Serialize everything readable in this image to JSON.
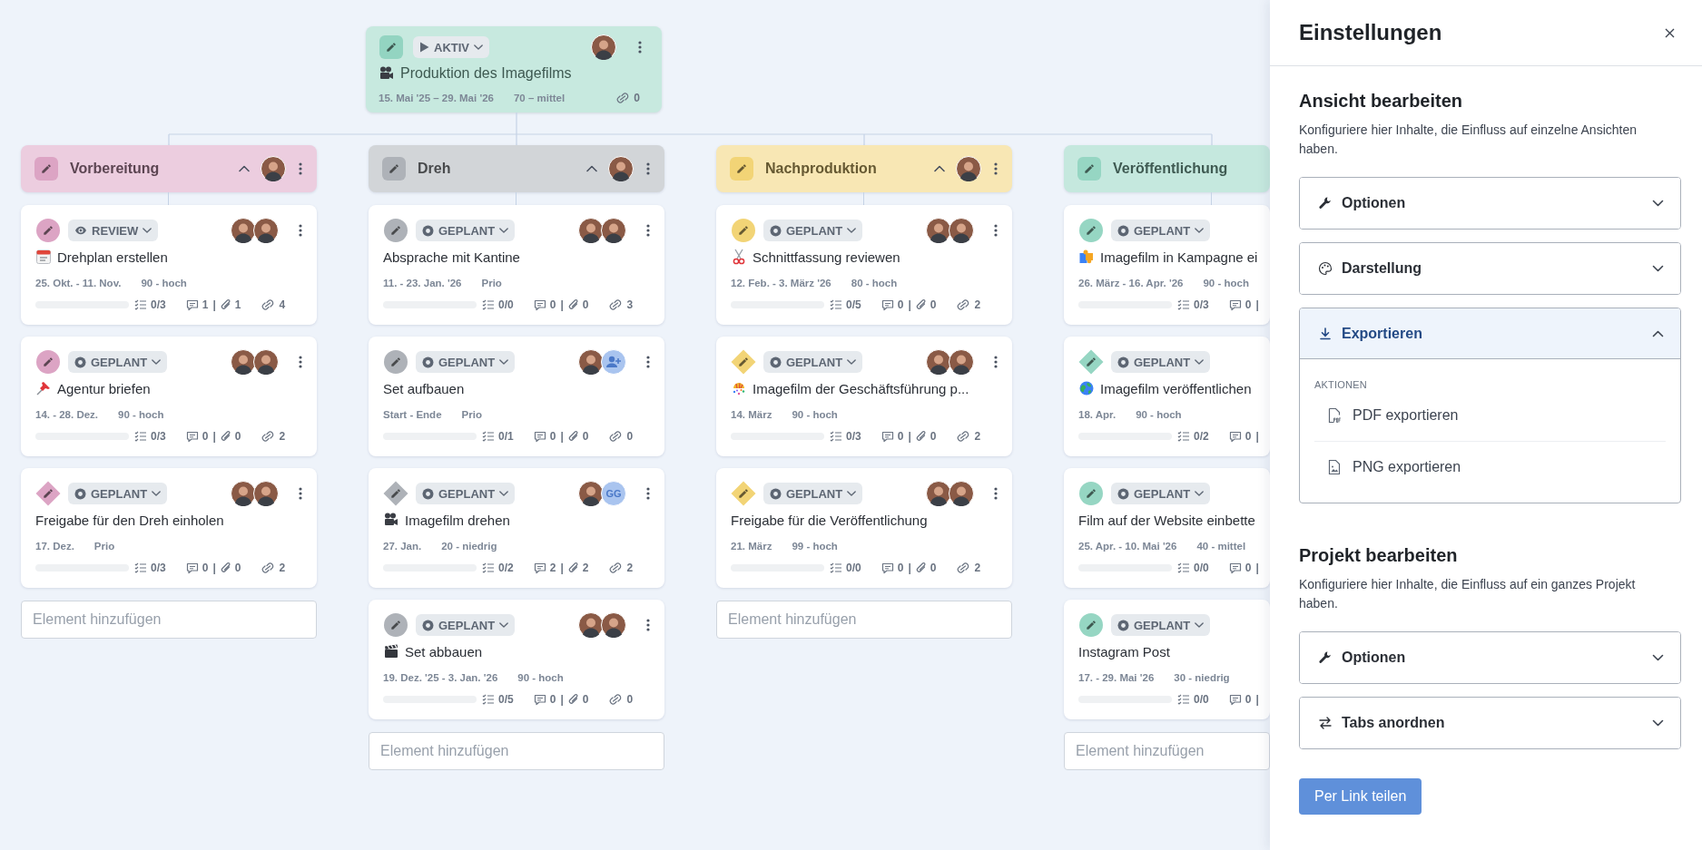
{
  "root_card": {
    "color": "#93d4c1",
    "status": {
      "kind": "active",
      "label": "AKTIV"
    },
    "avatars": [
      {
        "kind": "photo"
      }
    ],
    "title_icon": {
      "kind": "projector"
    },
    "title": "Produktion des Imagefilms",
    "date": "15. Mai '25 – 29. Mai '26",
    "priority": "70 – mittel",
    "links": "0"
  },
  "columns": [
    {
      "title": "Vorbereitung",
      "color": "#dca4c4",
      "collapse": true,
      "avatars": [
        {
          "kind": "photo"
        }
      ],
      "menu": true,
      "add_placeholder": "Element hinzufügen",
      "cards": [
        {
          "kind": "task",
          "status": {
            "kind": "review",
            "label": "REVIEW"
          },
          "avatars": [
            {
              "kind": "photo"
            },
            {
              "kind": "photo"
            }
          ],
          "menu": true,
          "title_icon": {
            "kind": "calendar"
          },
          "title": "Drehplan erstellen",
          "date": "25. Okt. - 11. Nov.",
          "priority": "90 - hoch",
          "level": 0,
          "stats": [
            {
              "kind": "checklist",
              "text": "0/3"
            },
            {
              "kind": "comments",
              "text": "1"
            },
            {
              "kind": "separator",
              "text": "|"
            },
            {
              "kind": "attachments",
              "text": "1"
            },
            {
              "kind": "links",
              "text": "4"
            }
          ]
        },
        {
          "kind": "task",
          "status": {
            "kind": "planned",
            "label": "GEPLANT"
          },
          "avatars": [
            {
              "kind": "photo"
            },
            {
              "kind": "photo"
            }
          ],
          "menu": true,
          "title_icon": {
            "kind": "pin"
          },
          "title": "Agentur briefen",
          "date": "14. - 28. Dez.",
          "priority": "90 - hoch",
          "level": 0,
          "stats": [
            {
              "kind": "checklist",
              "text": "0/3"
            },
            {
              "kind": "comments",
              "text": "0"
            },
            {
              "kind": "separator",
              "text": "|"
            },
            {
              "kind": "attachments",
              "text": "0"
            },
            {
              "kind": "links",
              "text": "2"
            }
          ]
        },
        {
          "kind": "milestone",
          "status": {
            "kind": "planned",
            "label": "GEPLANT"
          },
          "avatars": [
            {
              "kind": "photo"
            },
            {
              "kind": "photo"
            }
          ],
          "menu": true,
          "title": "Freigabe für den Dreh einholen",
          "date": "17. Dez.",
          "priority": "Prio",
          "level": 0,
          "stats": [
            {
              "kind": "checklist",
              "text": "0/3"
            },
            {
              "kind": "comments",
              "text": "0"
            },
            {
              "kind": "separator",
              "text": "|"
            },
            {
              "kind": "attachments",
              "text": "0"
            },
            {
              "kind": "links",
              "text": "2"
            }
          ]
        }
      ]
    },
    {
      "title": "Dreh",
      "color": "#aeb2b8",
      "collapse": true,
      "avatars": [
        {
          "kind": "photo"
        }
      ],
      "menu": true,
      "add_placeholder": "Element hinzufügen",
      "cards": [
        {
          "kind": "task",
          "status": {
            "kind": "planned",
            "label": "GEPLANT"
          },
          "avatars": [
            {
              "kind": "photo"
            },
            {
              "kind": "photo"
            }
          ],
          "menu": true,
          "title": "Absprache mit Kantine",
          "date": "11. - 23. Jan. '26",
          "priority": "Prio",
          "level": 0,
          "stats": [
            {
              "kind": "checklist",
              "text": "0/0"
            },
            {
              "kind": "comments",
              "text": "0"
            },
            {
              "kind": "separator",
              "text": "|"
            },
            {
              "kind": "attachments",
              "text": "0"
            },
            {
              "kind": "links",
              "text": "3"
            }
          ]
        },
        {
          "kind": "task",
          "status": {
            "kind": "planned",
            "label": "GEPLANT"
          },
          "avatars": [
            {
              "kind": "photo"
            },
            {
              "kind": "add"
            }
          ],
          "menu": true,
          "title": "Set aufbauen",
          "date": "Start - Ende",
          "priority": "Prio",
          "level": 0,
          "stats": [
            {
              "kind": "checklist",
              "text": "0/1"
            },
            {
              "kind": "comments",
              "text": "0"
            },
            {
              "kind": "separator",
              "text": "|"
            },
            {
              "kind": "attachments",
              "text": "0"
            },
            {
              "kind": "links",
              "text": "0"
            }
          ]
        },
        {
          "kind": "milestone",
          "status": {
            "kind": "planned",
            "label": "GEPLANT"
          },
          "avatars": [
            {
              "kind": "photo"
            },
            {
              "kind": "initials",
              "text": "GG"
            }
          ],
          "menu": true,
          "title_icon": {
            "kind": "projector"
          },
          "title": "Imagefilm drehen",
          "date": "27. Jan.",
          "priority": "20 - niedrig",
          "level": 0,
          "stats": [
            {
              "kind": "checklist",
              "text": "0/2"
            },
            {
              "kind": "comments",
              "text": "2"
            },
            {
              "kind": "separator",
              "text": "|"
            },
            {
              "kind": "attachments",
              "text": "2"
            },
            {
              "kind": "links",
              "text": "2"
            }
          ]
        },
        {
          "kind": "task",
          "status": {
            "kind": "planned",
            "label": "GEPLANT"
          },
          "avatars": [
            {
              "kind": "photo"
            },
            {
              "kind": "photo"
            }
          ],
          "menu": true,
          "title_icon": {
            "kind": "clapper"
          },
          "title": "Set abbauen",
          "date": "19. Dez. '25 - 3. Jan. '26",
          "priority": "90 - hoch",
          "level": 0,
          "stats": [
            {
              "kind": "checklist",
              "text": "0/5"
            },
            {
              "kind": "comments",
              "text": "0"
            },
            {
              "kind": "separator",
              "text": "|"
            },
            {
              "kind": "attachments",
              "text": "0"
            },
            {
              "kind": "links",
              "text": "0"
            }
          ]
        }
      ]
    },
    {
      "title": "Nachproduktion",
      "color": "#f2d476",
      "collapse": true,
      "avatars": [
        {
          "kind": "photo"
        }
      ],
      "menu": true,
      "add_placeholder": "Element hinzufügen",
      "cards": [
        {
          "kind": "task",
          "status": {
            "kind": "planned",
            "label": "GEPLANT"
          },
          "avatars": [
            {
              "kind": "photo"
            },
            {
              "kind": "photo"
            }
          ],
          "menu": true,
          "title_icon": {
            "kind": "scissors"
          },
          "title": "Schnittfassung reviewen",
          "date": "12. Feb. - 3. März '26",
          "priority": "80 - hoch",
          "level": 0,
          "stats": [
            {
              "kind": "checklist",
              "text": "0/5"
            },
            {
              "kind": "comments",
              "text": "0"
            },
            {
              "kind": "separator",
              "text": "|"
            },
            {
              "kind": "attachments",
              "text": "0"
            },
            {
              "kind": "links",
              "text": "2"
            }
          ]
        },
        {
          "kind": "milestone",
          "status": {
            "kind": "planned",
            "label": "GEPLANT"
          },
          "avatars": [
            {
              "kind": "photo"
            },
            {
              "kind": "photo"
            }
          ],
          "menu": true,
          "title_icon": {
            "kind": "confetti"
          },
          "title": "Imagefilm der Geschäftsführung p...",
          "date": "14. März",
          "priority": "90 - hoch",
          "level": 0,
          "stats": [
            {
              "kind": "checklist",
              "text": "0/3"
            },
            {
              "kind": "comments",
              "text": "0"
            },
            {
              "kind": "separator",
              "text": "|"
            },
            {
              "kind": "attachments",
              "text": "0"
            },
            {
              "kind": "links",
              "text": "2"
            }
          ]
        },
        {
          "kind": "milestone",
          "status": {
            "kind": "planned",
            "label": "GEPLANT"
          },
          "avatars": [
            {
              "kind": "photo"
            },
            {
              "kind": "photo"
            }
          ],
          "menu": true,
          "title": "Freigabe für die Veröffentlichung",
          "date": "21. März",
          "priority": "99 - hoch",
          "level": 0,
          "stats": [
            {
              "kind": "checklist",
              "text": "0/0"
            },
            {
              "kind": "comments",
              "text": "0"
            },
            {
              "kind": "separator",
              "text": "|"
            },
            {
              "kind": "attachments",
              "text": "0"
            },
            {
              "kind": "links",
              "text": "2"
            }
          ]
        }
      ]
    },
    {
      "title": "Veröffentlichung",
      "color": "#96d6c3",
      "collapse": false,
      "menu": false,
      "add_placeholder": "Element hinzufügen",
      "cards": [
        {
          "kind": "task",
          "status": {
            "kind": "planned",
            "label": "GEPLANT"
          },
          "menu": false,
          "title_icon": {
            "kind": "puzzle"
          },
          "title": "Imagefilm in Kampagne ei",
          "date": "26. März - 16. Apr. '26",
          "priority": "90 - hoch",
          "level": 0,
          "stats": [
            {
              "kind": "checklist",
              "text": "0/3"
            },
            {
              "kind": "comments",
              "text": "0"
            },
            {
              "kind": "separator",
              "text": "|"
            }
          ]
        },
        {
          "kind": "milestone",
          "status": {
            "kind": "planned",
            "label": "GEPLANT"
          },
          "menu": false,
          "title_icon": {
            "kind": "globe"
          },
          "title": "Imagefilm veröffentlichen",
          "date": "18. Apr.",
          "priority": "90 - hoch",
          "level": 0,
          "stats": [
            {
              "kind": "checklist",
              "text": "0/2"
            },
            {
              "kind": "comments",
              "text": "0"
            },
            {
              "kind": "separator",
              "text": "|"
            }
          ]
        },
        {
          "kind": "task",
          "status": {
            "kind": "planned",
            "label": "GEPLANT"
          },
          "menu": false,
          "title": "Film auf der Website einbette",
          "date": "25. Apr. - 10. Mai '26",
          "priority": "40 - mittel",
          "level": 0,
          "stats": [
            {
              "kind": "checklist",
              "text": "0/0"
            },
            {
              "kind": "comments",
              "text": "0"
            },
            {
              "kind": "separator",
              "text": "|"
            }
          ]
        },
        {
          "kind": "task",
          "status": {
            "kind": "planned",
            "label": "GEPLANT"
          },
          "menu": false,
          "title": "Instagram Post",
          "date": "17. - 29. Mai '26",
          "priority": "30 - niedrig",
          "level": 0,
          "stats": [
            {
              "kind": "checklist",
              "text": "0/0"
            },
            {
              "kind": "comments",
              "text": "0"
            },
            {
              "kind": "separator",
              "text": "|"
            }
          ]
        }
      ]
    }
  ],
  "panel": {
    "title": "Einstellungen",
    "sections": [
      {
        "title": "Ansicht bearbeiten",
        "description": "Konfiguriere hier Inhalte, die Einfluss auf einzelne Ansichten haben.",
        "accordions": [
          {
            "kind": "wrench",
            "label": "Optionen",
            "expanded": false
          },
          {
            "kind": "palette",
            "label": "Darstellung",
            "expanded": false
          },
          {
            "kind": "download",
            "label": "Exportieren",
            "expanded": true,
            "group_label": "AKTIONEN",
            "actions": [
              {
                "kind": "pdf",
                "label": "PDF exportieren"
              },
              {
                "kind": "image",
                "label": "PNG exportieren"
              }
            ]
          }
        ]
      },
      {
        "title": "Projekt bearbeiten",
        "description": "Konfiguriere hier Inhalte, die Einfluss auf ein ganzes Projekt haben.",
        "accordions": [
          {
            "kind": "wrench",
            "label": "Optionen",
            "expanded": false
          },
          {
            "kind": "swap",
            "label": "Tabs anordnen",
            "expanded": false
          }
        ]
      }
    ],
    "share_button": "Per Link teilen"
  }
}
